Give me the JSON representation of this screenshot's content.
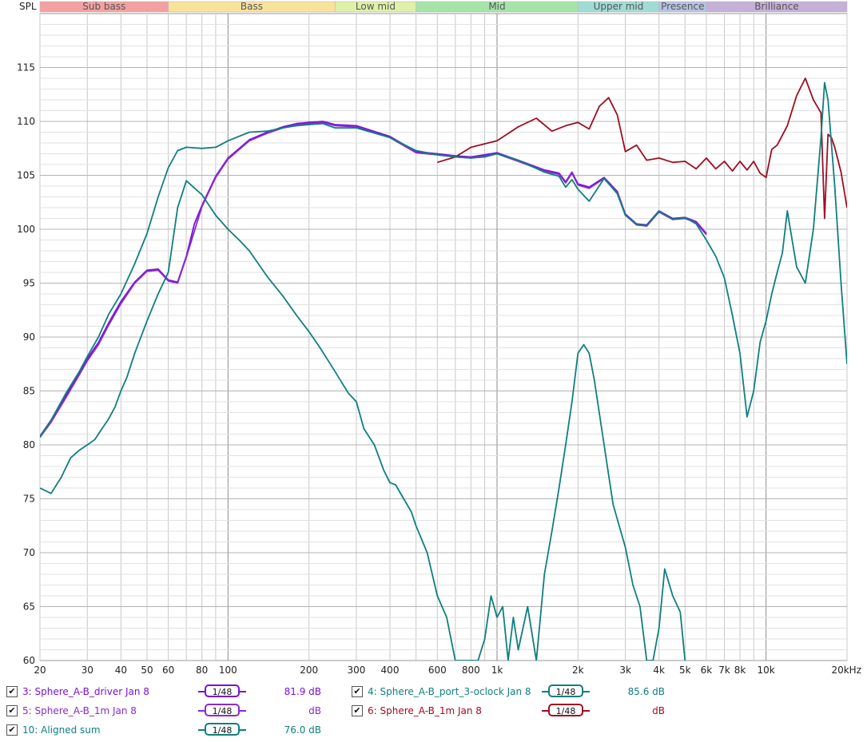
{
  "colors": {
    "driver": "#7a10d8",
    "port": "#0f7f7f",
    "m1_5": "#8a2ad0",
    "m1_6": "#a00c24",
    "sum": "#0f7f7f",
    "grid": "#c8c8c8",
    "grid_major": "#8c8c8c"
  },
  "chart_data": {
    "type": "line",
    "ylabel": "SPL",
    "xscale": "log",
    "xlim": [
      20,
      20000
    ],
    "ylim": [
      60,
      120
    ],
    "x_ticks": [
      {
        "v": 20,
        "label": "20"
      },
      {
        "v": 30,
        "label": "30"
      },
      {
        "v": 40,
        "label": "40"
      },
      {
        "v": 50,
        "label": "50"
      },
      {
        "v": 60,
        "label": "60"
      },
      {
        "v": 80,
        "label": "80"
      },
      {
        "v": 100,
        "label": "100"
      },
      {
        "v": 200,
        "label": "200"
      },
      {
        "v": 300,
        "label": "300"
      },
      {
        "v": 400,
        "label": "400"
      },
      {
        "v": 600,
        "label": "600"
      },
      {
        "v": 800,
        "label": "800"
      },
      {
        "v": 1000,
        "label": "1k"
      },
      {
        "v": 2000,
        "label": "2k"
      },
      {
        "v": 3000,
        "label": "3k"
      },
      {
        "v": 4000,
        "label": "4k"
      },
      {
        "v": 5000,
        "label": "5k"
      },
      {
        "v": 6000,
        "label": "6k"
      },
      {
        "v": 7000,
        "label": "7k"
      },
      {
        "v": 8000,
        "label": "8k"
      },
      {
        "v": 10000,
        "label": "10k"
      },
      {
        "v": 20000,
        "label": "20kHz"
      }
    ],
    "y_ticks": [
      60,
      65,
      70,
      75,
      80,
      85,
      90,
      95,
      100,
      105,
      110,
      115
    ],
    "bands": [
      {
        "label": "Sub bass",
        "from": 20,
        "to": 60,
        "color": "#f4a0a0"
      },
      {
        "label": "Bass",
        "from": 60,
        "to": 250,
        "color": "#f9e29a"
      },
      {
        "label": "Low mid",
        "from": 250,
        "to": 500,
        "color": "#dff0a8"
      },
      {
        "label": "Mid",
        "from": 500,
        "to": 2000,
        "color": "#a4e4a8"
      },
      {
        "label": "Upper mid",
        "from": 2000,
        "to": 4000,
        "color": "#a0dcd4"
      },
      {
        "label": "Presence",
        "from": 4000,
        "to": 6000,
        "color": "#b4c4e4"
      },
      {
        "label": "Brilliance",
        "from": 6000,
        "to": 20000,
        "color": "#c4b0d8"
      }
    ],
    "series": [
      {
        "name": "3: Sphere_A-B_driver Jan 8",
        "color": "#7a10d8",
        "x": [
          20,
          22,
          25,
          28,
          30,
          33,
          36,
          40,
          45,
          50,
          55,
          60,
          65,
          70,
          75,
          80,
          90,
          100,
          120,
          140,
          160,
          180,
          200,
          225,
          250,
          300,
          400,
          500,
          600,
          700,
          800,
          900,
          1000,
          1200,
          1500,
          1700,
          1800,
          1900,
          2000,
          2200,
          2500,
          2800,
          3000,
          3300,
          3600,
          4000,
          4500,
          5000,
          5500,
          6000
        ],
        "y": [
          80.8,
          82.3,
          84.6,
          86.7,
          88.0,
          89.5,
          91.3,
          93.3,
          95.1,
          96.2,
          96.3,
          95.3,
          95.1,
          97.5,
          100.5,
          102.2,
          104.9,
          106.6,
          108.3,
          109.0,
          109.5,
          109.8,
          109.9,
          110.0,
          109.7,
          109.6,
          108.6,
          107.2,
          107.0,
          106.8,
          106.7,
          106.9,
          107.1,
          106.4,
          105.5,
          105.2,
          104.4,
          105.3,
          104.2,
          103.9,
          104.8,
          103.5,
          101.4,
          100.5,
          100.4,
          101.7,
          101.0,
          101.1,
          100.7,
          99.6
        ]
      },
      {
        "name": "4: Sphere_A-B_port_3-oclock Jan 8",
        "color": "#0f7f7f",
        "x": [
          20,
          22,
          24,
          26,
          28,
          30,
          32,
          34,
          36,
          38,
          40,
          42,
          45,
          50,
          55,
          60,
          65,
          70,
          80,
          90,
          100,
          110,
          120,
          140,
          160,
          180,
          200,
          220,
          250,
          280,
          300,
          320,
          350,
          380,
          400,
          420,
          450,
          480,
          500,
          550,
          600,
          650,
          700,
          750,
          800,
          850,
          900,
          950,
          1000,
          1050,
          1100,
          1150,
          1200,
          1300,
          1400,
          1500,
          1600,
          1700,
          1800,
          1900,
          2000,
          2100,
          2200,
          2300,
          2500,
          2700,
          3000,
          3200,
          3400,
          3600,
          3800,
          4000,
          4200,
          4500,
          4800,
          5000
        ],
        "y": [
          76.0,
          75.5,
          77.0,
          78.8,
          79.5,
          80.0,
          80.5,
          81.5,
          82.4,
          83.5,
          85.0,
          86.2,
          88.5,
          91.5,
          94.0,
          96.0,
          102.0,
          104.5,
          103.2,
          101.3,
          100.0,
          99.0,
          98.0,
          95.6,
          93.8,
          92.0,
          90.5,
          89.0,
          86.8,
          84.8,
          84.0,
          81.5,
          80.0,
          77.6,
          76.5,
          76.3,
          75.0,
          73.8,
          72.5,
          70.0,
          66.0,
          64.0,
          60.0,
          60.0,
          60.0,
          60.0,
          62.0,
          66.0,
          64.0,
          65.0,
          60.0,
          64.0,
          61.0,
          65.0,
          60.0,
          68.0,
          72.0,
          76.0,
          80.0,
          84.0,
          88.5,
          89.3,
          88.5,
          86.0,
          80.0,
          74.5,
          70.5,
          67.0,
          65.0,
          60.0,
          60.0,
          63.0,
          68.5,
          66.0,
          64.5,
          60.0
        ]
      },
      {
        "name": "5: Sphere_A-B_1m Jan 8",
        "color": "#8a2ad0",
        "x": [
          20,
          22,
          25,
          28,
          30,
          33,
          36,
          40,
          45,
          50,
          55,
          60,
          65,
          70,
          80,
          90,
          100,
          120,
          140,
          160,
          180,
          200,
          225,
          250,
          300,
          400,
          500,
          600,
          700,
          800,
          900,
          1000,
          1200,
          1500,
          1700,
          1800,
          1900,
          2000,
          2200,
          2500,
          2800,
          3000,
          3300,
          3600,
          4000,
          4500,
          5000,
          5500,
          6000
        ],
        "y": [
          80.7,
          82.1,
          84.4,
          86.5,
          87.8,
          89.3,
          91.1,
          93.1,
          95.0,
          96.1,
          96.2,
          95.2,
          95.0,
          97.4,
          102.1,
          104.8,
          106.5,
          108.2,
          108.9,
          109.4,
          109.7,
          109.8,
          109.9,
          109.6,
          109.5,
          108.5,
          107.1,
          106.9,
          106.7,
          106.6,
          106.8,
          107.0,
          106.3,
          105.4,
          105.1,
          104.3,
          105.2,
          104.1,
          103.8,
          104.7,
          103.4,
          101.3,
          100.4,
          100.3,
          101.6,
          100.9,
          101.0,
          100.6,
          99.5
        ]
      },
      {
        "name": "6: Sphere_A-B_1m Jan 8",
        "color": "#a00c24",
        "x": [
          600,
          700,
          800,
          1000,
          1200,
          1400,
          1600,
          1800,
          2000,
          2200,
          2400,
          2600,
          2800,
          3000,
          3300,
          3600,
          4000,
          4500,
          5000,
          5500,
          6000,
          6500,
          7000,
          7500,
          8000,
          8500,
          9000,
          9500,
          10000,
          10500,
          11000,
          12000,
          13000,
          14000,
          15000,
          16000,
          16500,
          17000,
          17500,
          18000,
          19000,
          20000
        ],
        "y": [
          106.2,
          106.7,
          107.6,
          108.2,
          109.5,
          110.3,
          109.1,
          109.6,
          109.9,
          109.3,
          111.4,
          112.2,
          110.6,
          107.2,
          107.8,
          106.4,
          106.6,
          106.2,
          106.3,
          105.6,
          106.6,
          105.6,
          106.3,
          105.4,
          106.3,
          105.5,
          106.3,
          105.2,
          104.8,
          107.4,
          107.8,
          109.6,
          112.4,
          114.0,
          112.0,
          110.8,
          101.0,
          108.8,
          108.5,
          107.6,
          105.3,
          102.0
        ]
      },
      {
        "name": "10: Aligned sum",
        "color": "#0f7f7f",
        "x": [
          20,
          22,
          25,
          28,
          30,
          33,
          36,
          40,
          45,
          50,
          55,
          60,
          65,
          70,
          80,
          90,
          100,
          120,
          140,
          160,
          180,
          200,
          225,
          250,
          300,
          400,
          500,
          600,
          700,
          800,
          900,
          1000,
          1200,
          1500,
          1700,
          1800,
          1900,
          2000,
          2200,
          2500,
          2800,
          3000,
          3300,
          3600,
          4000,
          4500,
          5000,
          5500,
          6000,
          6500,
          7000,
          7500,
          8000,
          8500,
          9000,
          9500,
          10000,
          10500,
          11000,
          11500,
          12000,
          12500,
          13000,
          14000,
          15000,
          16000,
          16500,
          17000,
          18000,
          19000,
          20000
        ],
        "y": [
          80.7,
          82.3,
          84.8,
          86.8,
          88.2,
          90.0,
          92.1,
          94.0,
          96.8,
          99.6,
          103.0,
          105.7,
          107.3,
          107.6,
          107.5,
          107.6,
          108.2,
          109.0,
          109.1,
          109.4,
          109.6,
          109.7,
          109.8,
          109.4,
          109.4,
          108.5,
          107.3,
          106.9,
          106.7,
          106.6,
          106.7,
          107.0,
          106.4,
          105.3,
          104.9,
          103.9,
          104.6,
          103.7,
          102.6,
          104.7,
          103.3,
          101.3,
          100.5,
          100.3,
          101.7,
          100.9,
          101.1,
          100.5,
          99.0,
          97.5,
          95.5,
          92.0,
          88.5,
          82.6,
          85.0,
          89.5,
          91.5,
          94.0,
          96.0,
          97.8,
          101.7,
          99.0,
          96.5,
          95.0,
          100.0,
          108.5,
          113.6,
          112.0,
          104.0,
          95.0,
          87.5
        ]
      }
    ]
  },
  "legend": {
    "smoothing": "1/48",
    "items": [
      {
        "label": "3: Sphere_A-B_driver Jan 8",
        "value": "81.9 dB",
        "color": "#7a10d8"
      },
      {
        "label": "4: Sphere_A-B_port_3-oclock Jan 8",
        "value": "85.6 dB",
        "color": "#0f7f7f"
      },
      {
        "label": "5: Sphere_A-B_1m Jan 8",
        "value": "dB",
        "color": "#8a2ad0"
      },
      {
        "label": "6: Sphere_A-B_1m Jan 8",
        "value": "dB",
        "color": "#a00c24"
      },
      {
        "label": "10: Aligned sum",
        "value": "76.0 dB",
        "color": "#0f7f7f"
      }
    ]
  }
}
